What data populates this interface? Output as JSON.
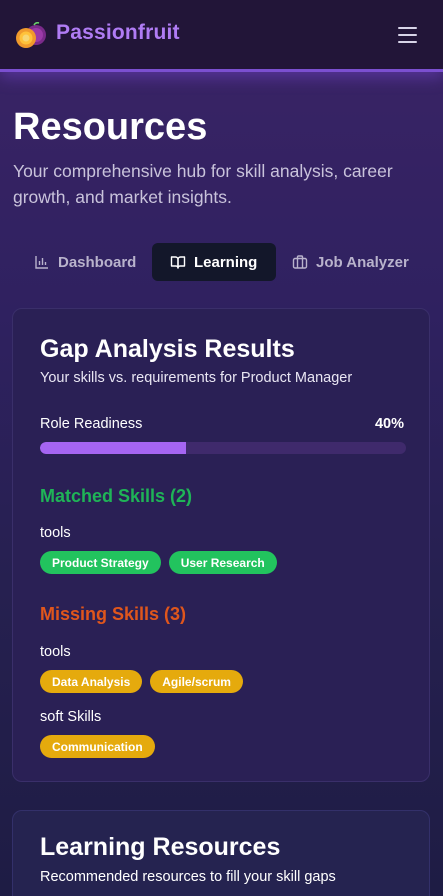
{
  "header": {
    "brand": "Passionfruit",
    "logo_icon": "passionfruit-logo-icon",
    "menu_icon": "hamburger-menu-icon"
  },
  "hero": {
    "title": "Resources",
    "subtitle": "Your comprehensive hub for skill analysis, career growth, and market insights."
  },
  "tabs": [
    {
      "label": "Dashboard",
      "icon": "bar-chart-icon",
      "active": false
    },
    {
      "label": "Learning",
      "icon": "open-book-icon",
      "active": true
    },
    {
      "label": "Job Analyzer",
      "icon": "briefcase-icon",
      "active": false
    }
  ],
  "gap_analysis": {
    "title": "Gap Analysis Results",
    "subtitle": "Your skills vs. requirements for Product Manager",
    "readiness_label": "Role Readiness",
    "readiness_text": "40%",
    "readiness_value": 40,
    "matched": {
      "title": "Matched Skills (2)",
      "groups": [
        {
          "label": "tools",
          "skills": [
            "Product Strategy",
            "User Research"
          ]
        }
      ]
    },
    "missing": {
      "title": "Missing Skills (3)",
      "groups": [
        {
          "label": "tools",
          "skills": [
            "Data Analysis",
            "Agile/scrum"
          ]
        },
        {
          "label": "soft Skills",
          "skills": [
            "Communication"
          ]
        }
      ]
    }
  },
  "learning_resources": {
    "title": "Learning Resources",
    "subtitle": "Recommended resources to fill your skill gaps"
  },
  "colors": {
    "brand": "#b07cf4",
    "progress": "#a565f2",
    "matched": "#1fb457",
    "missing": "#e0561c",
    "chip_matched": "#22c35e",
    "chip_missing": "#e5aa0d"
  }
}
